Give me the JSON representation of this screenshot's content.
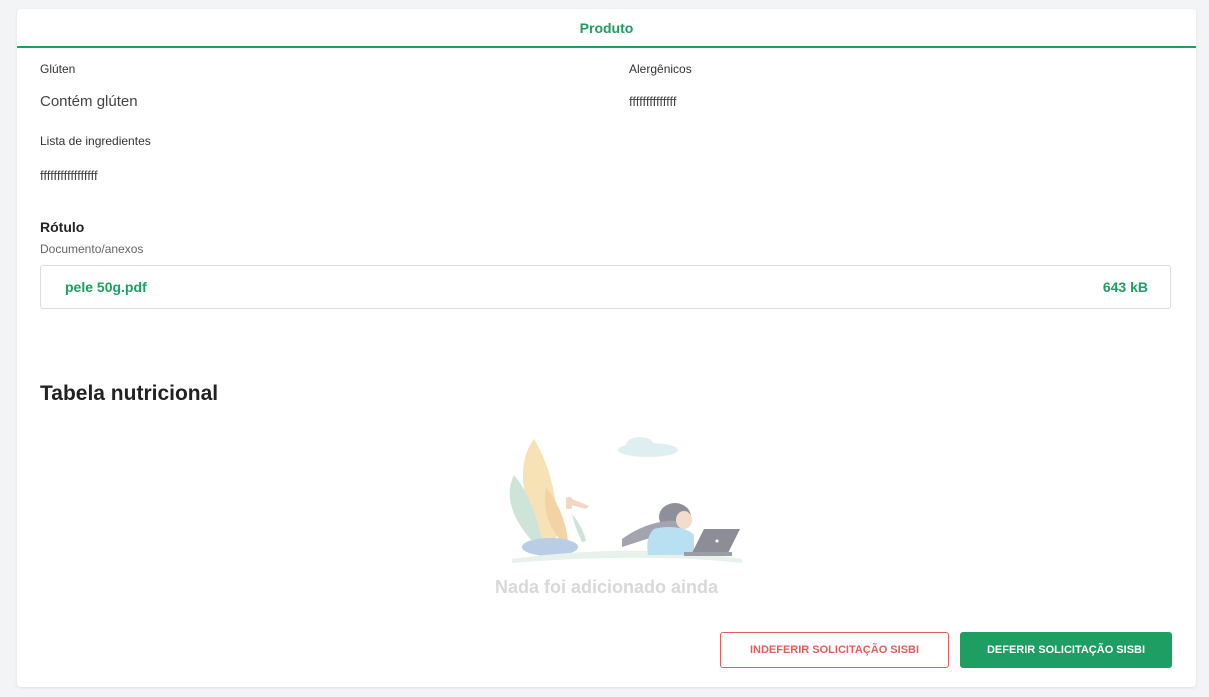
{
  "header": {
    "title": "Produto"
  },
  "fields": {
    "gluten_label": "Glúten",
    "gluten_value": "Contém glúten",
    "allergens_label": "Alergênicos",
    "allergens_value": "ffffffffffffff",
    "ingredients_label": "Lista de ingredientes",
    "ingredients_value": "fffffffffffffffff"
  },
  "label_section": {
    "title": "Rótulo",
    "subtitle": "Documento/anexos",
    "file": {
      "name": "pele 50g.pdf",
      "size": "643 kB"
    }
  },
  "nutrition": {
    "title": "Tabela nutricional",
    "empty_message": "Nada foi adicionado ainda"
  },
  "actions": {
    "reject_label": "INDEFERIR SOLICITAÇÃO SISBI",
    "approve_label": "DEFERIR SOLICITAÇÃO SISBI"
  },
  "colors": {
    "accent": "#1e9e62",
    "danger": "#e35d5d"
  }
}
